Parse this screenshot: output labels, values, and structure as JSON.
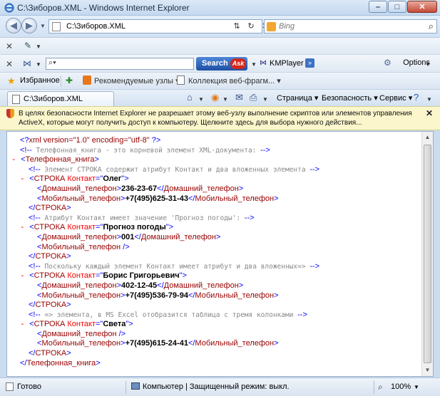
{
  "window": {
    "title": "C:\\Зиборов.XML - Windows Internet Explorer",
    "minimize": "–",
    "maximize": "□",
    "close": "✕"
  },
  "address": {
    "url": "C:\\Зиборов.XML",
    "search_placeholder": "Bing"
  },
  "ask_toolbar": {
    "search_button": "Search",
    "ask_logo": "Ask",
    "kmplayer": "KMPlayer",
    "options": "Options"
  },
  "favorites": {
    "label": "Избранное",
    "link1": "Рекомендуемые узлы ▾",
    "link2": "Коллекция веб-фрагм... ▾"
  },
  "tab": {
    "label": "C:\\Зиборов.XML"
  },
  "commands": {
    "page": "Страница ▾",
    "security": "Безопасность ▾",
    "service": "Сервис ▾"
  },
  "infobar": {
    "text": "В целях безопасности Internet Explorer не разрешает этому веб-узлу выполнение скриптов или элементов управления ActiveX, которые могут получить доступ к компьютеру. Щелкните здесь для выбора нужного действия..."
  },
  "xml_lines": [
    {
      "indent": 1,
      "minus": false,
      "parts": [
        {
          "c": "blue",
          "t": "<?"
        },
        {
          "c": "maroon",
          "t": "xml version=\"1.0\" encoding=\"utf-8\""
        },
        {
          "c": "blue",
          "t": " ?>"
        }
      ]
    },
    {
      "indent": 1,
      "minus": false,
      "parts": [
        {
          "c": "blue",
          "t": "<!--"
        },
        {
          "c": "gray mono",
          "t": " Телефонная_книга - это корневой элемент XML-документа: "
        },
        {
          "c": "blue",
          "t": "-->"
        }
      ]
    },
    {
      "indent": 0,
      "minus": true,
      "parts": [
        {
          "c": "blue",
          "t": "<"
        },
        {
          "c": "maroon",
          "t": "Телефонная_книга"
        },
        {
          "c": "blue",
          "t": ">"
        }
      ]
    },
    {
      "indent": 2,
      "minus": false,
      "parts": [
        {
          "c": "blue",
          "t": "<!--"
        },
        {
          "c": "gray mono",
          "t": " Элемент СТРОКА содержит атрибут Контакт и два вложенных элемента "
        },
        {
          "c": "blue",
          "t": "-->"
        }
      ]
    },
    {
      "indent": 1,
      "minus": true,
      "parts": [
        {
          "c": "blue",
          "t": "<"
        },
        {
          "c": "maroon",
          "t": "СТРОКА "
        },
        {
          "c": "red",
          "t": "Контакт"
        },
        {
          "c": "blue",
          "t": "=\""
        },
        {
          "c": "black bold",
          "t": "Олег"
        },
        {
          "c": "blue",
          "t": "\">"
        }
      ]
    },
    {
      "indent": 3,
      "minus": false,
      "parts": [
        {
          "c": "blue",
          "t": "<"
        },
        {
          "c": "maroon",
          "t": "Домашний_телефон"
        },
        {
          "c": "blue",
          "t": ">"
        },
        {
          "c": "black bold",
          "t": "236-23-67"
        },
        {
          "c": "blue",
          "t": "</"
        },
        {
          "c": "maroon",
          "t": "Домашний_телефон"
        },
        {
          "c": "blue",
          "t": ">"
        }
      ]
    },
    {
      "indent": 3,
      "minus": false,
      "parts": [
        {
          "c": "blue",
          "t": "<"
        },
        {
          "c": "maroon",
          "t": "Мобильный_телефон"
        },
        {
          "c": "blue",
          "t": ">"
        },
        {
          "c": "black bold",
          "t": "+7(495)625-31-43"
        },
        {
          "c": "blue",
          "t": "</"
        },
        {
          "c": "maroon",
          "t": "Мобильный_телефон"
        },
        {
          "c": "blue",
          "t": ">"
        }
      ]
    },
    {
      "indent": 2,
      "minus": false,
      "parts": [
        {
          "c": "blue",
          "t": "</"
        },
        {
          "c": "maroon",
          "t": "СТРОКА"
        },
        {
          "c": "blue",
          "t": ">"
        }
      ]
    },
    {
      "indent": 2,
      "minus": false,
      "parts": [
        {
          "c": "blue",
          "t": "<!--"
        },
        {
          "c": "gray mono",
          "t": " Атрибут Контакт имеет значение 'Прогноз погоды': "
        },
        {
          "c": "blue",
          "t": "-->"
        }
      ]
    },
    {
      "indent": 1,
      "minus": true,
      "parts": [
        {
          "c": "blue",
          "t": "<"
        },
        {
          "c": "maroon",
          "t": "СТРОКА "
        },
        {
          "c": "red",
          "t": "Контакт"
        },
        {
          "c": "blue",
          "t": "=\""
        },
        {
          "c": "black bold",
          "t": "Прогноз погоды"
        },
        {
          "c": "blue",
          "t": "\">"
        }
      ]
    },
    {
      "indent": 3,
      "minus": false,
      "parts": [
        {
          "c": "blue",
          "t": "<"
        },
        {
          "c": "maroon",
          "t": "Домашний_телефон"
        },
        {
          "c": "blue",
          "t": ">"
        },
        {
          "c": "black bold",
          "t": "001"
        },
        {
          "c": "blue",
          "t": "</"
        },
        {
          "c": "maroon",
          "t": "Домашний_телефон"
        },
        {
          "c": "blue",
          "t": ">"
        }
      ]
    },
    {
      "indent": 3,
      "minus": false,
      "parts": [
        {
          "c": "blue",
          "t": "<"
        },
        {
          "c": "maroon",
          "t": "Мобильный_телефон"
        },
        {
          "c": "blue",
          "t": " />"
        }
      ]
    },
    {
      "indent": 2,
      "minus": false,
      "parts": [
        {
          "c": "blue",
          "t": "</"
        },
        {
          "c": "maroon",
          "t": "СТРОКА"
        },
        {
          "c": "blue",
          "t": ">"
        }
      ]
    },
    {
      "indent": 2,
      "minus": false,
      "parts": [
        {
          "c": "blue",
          "t": "<!--"
        },
        {
          "c": "gray mono",
          "t": " Поскольку каждый элемент Контакт имеет атрибут и два вложенных=> "
        },
        {
          "c": "blue",
          "t": "-->"
        }
      ]
    },
    {
      "indent": 1,
      "minus": true,
      "parts": [
        {
          "c": "blue",
          "t": "<"
        },
        {
          "c": "maroon",
          "t": "СТРОКА "
        },
        {
          "c": "red",
          "t": "Контакт"
        },
        {
          "c": "blue",
          "t": "=\""
        },
        {
          "c": "black bold",
          "t": "Борис Григорьевич"
        },
        {
          "c": "blue",
          "t": "\">"
        }
      ]
    },
    {
      "indent": 3,
      "minus": false,
      "parts": [
        {
          "c": "blue",
          "t": "<"
        },
        {
          "c": "maroon",
          "t": "Домашний_телефон"
        },
        {
          "c": "blue",
          "t": ">"
        },
        {
          "c": "black bold",
          "t": "402-12-45"
        },
        {
          "c": "blue",
          "t": "</"
        },
        {
          "c": "maroon",
          "t": "Домашний_телефон"
        },
        {
          "c": "blue",
          "t": ">"
        }
      ]
    },
    {
      "indent": 3,
      "minus": false,
      "parts": [
        {
          "c": "blue",
          "t": "<"
        },
        {
          "c": "maroon",
          "t": "Мобильный_телефон"
        },
        {
          "c": "blue",
          "t": ">"
        },
        {
          "c": "black bold",
          "t": "+7(495)536-79-94"
        },
        {
          "c": "blue",
          "t": "</"
        },
        {
          "c": "maroon",
          "t": "Мобильный_телефон"
        },
        {
          "c": "blue",
          "t": ">"
        }
      ]
    },
    {
      "indent": 2,
      "minus": false,
      "parts": [
        {
          "c": "blue",
          "t": "</"
        },
        {
          "c": "maroon",
          "t": "СТРОКА"
        },
        {
          "c": "blue",
          "t": ">"
        }
      ]
    },
    {
      "indent": 2,
      "minus": false,
      "parts": [
        {
          "c": "blue",
          "t": "<!--"
        },
        {
          "c": "gray mono",
          "t": " => элемента, в MS Excel отобразится таблица с тремя колонками "
        },
        {
          "c": "blue",
          "t": "-->"
        }
      ]
    },
    {
      "indent": 1,
      "minus": true,
      "parts": [
        {
          "c": "blue",
          "t": "<"
        },
        {
          "c": "maroon",
          "t": "СТРОКА "
        },
        {
          "c": "red",
          "t": "Контакт"
        },
        {
          "c": "blue",
          "t": "=\""
        },
        {
          "c": "black bold",
          "t": "Света"
        },
        {
          "c": "blue",
          "t": "\">"
        }
      ]
    },
    {
      "indent": 3,
      "minus": false,
      "parts": [
        {
          "c": "blue",
          "t": "<"
        },
        {
          "c": "maroon",
          "t": "Домашний_телефон"
        },
        {
          "c": "blue",
          "t": " />"
        }
      ]
    },
    {
      "indent": 3,
      "minus": false,
      "parts": [
        {
          "c": "blue",
          "t": "<"
        },
        {
          "c": "maroon",
          "t": "Мобильный_телефон"
        },
        {
          "c": "blue",
          "t": ">"
        },
        {
          "c": "black bold",
          "t": "+7(495)615-24-41"
        },
        {
          "c": "blue",
          "t": "</"
        },
        {
          "c": "maroon",
          "t": "Мобильный_телефон"
        },
        {
          "c": "blue",
          "t": ">"
        }
      ]
    },
    {
      "indent": 2,
      "minus": false,
      "parts": [
        {
          "c": "blue",
          "t": "</"
        },
        {
          "c": "maroon",
          "t": "СТРОКА"
        },
        {
          "c": "blue",
          "t": ">"
        }
      ]
    },
    {
      "indent": 1,
      "minus": false,
      "parts": [
        {
          "c": "blue",
          "t": "</"
        },
        {
          "c": "maroon",
          "t": "Телефонная_книга"
        },
        {
          "c": "blue",
          "t": ">"
        }
      ]
    }
  ],
  "status": {
    "text": "Готово",
    "zone": "Компьютер | Защищенный режим: выкл.",
    "zoom": "100%"
  },
  "icons": {
    "back": "back-arrow-icon",
    "forward": "forward-arrow-icon",
    "refresh": "refresh-icon",
    "stop": "stop-icon",
    "search": "magnifier-icon",
    "favorites": "star-icon",
    "home": "home-icon",
    "feeds": "rss-icon",
    "mail": "mail-icon",
    "print": "printer-icon",
    "help": "help-icon"
  }
}
